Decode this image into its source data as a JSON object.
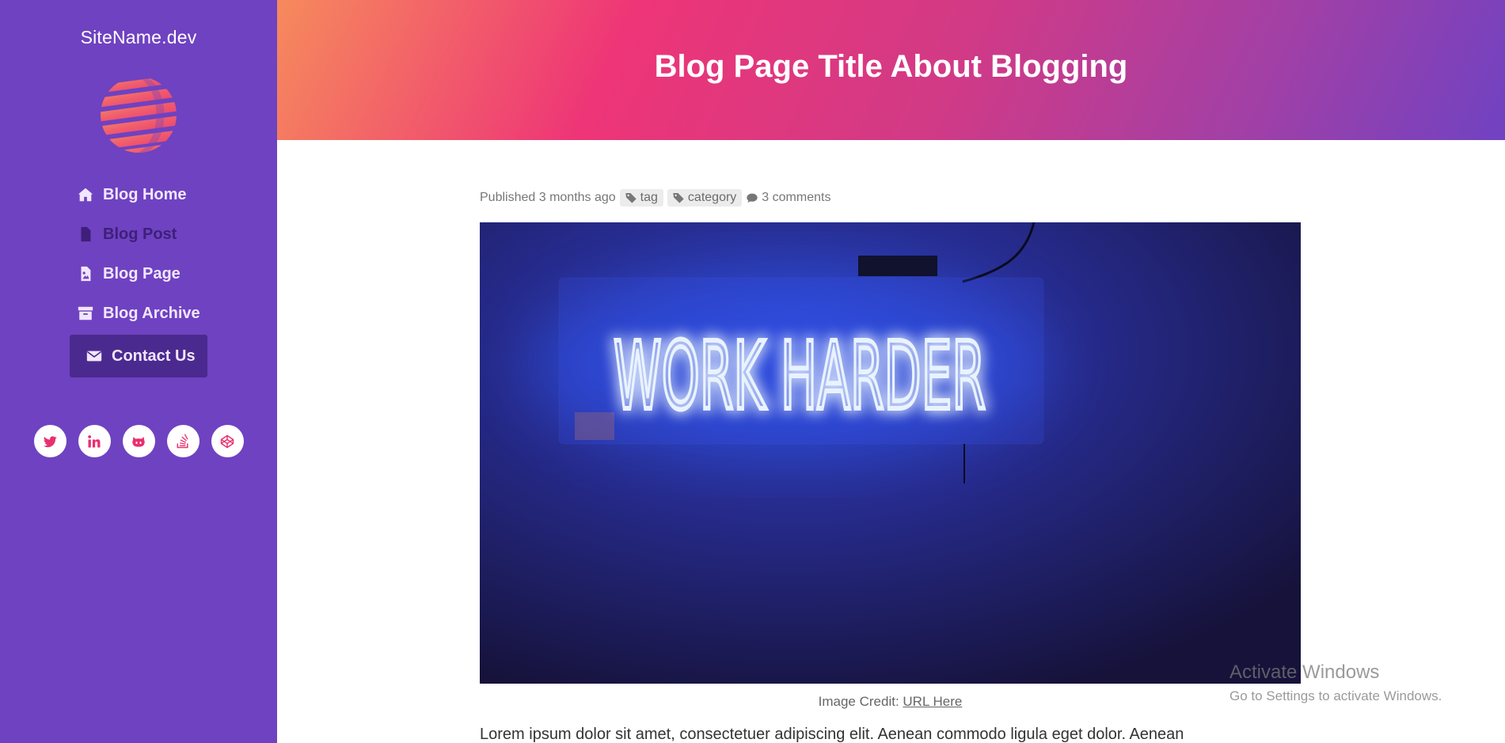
{
  "sidebar": {
    "site_name": "SiteName.dev",
    "logo_icon": "striped-globe-logo",
    "nav": [
      {
        "label": "Blog Home",
        "icon": "home-icon"
      },
      {
        "label": "Blog Post",
        "icon": "file-text-icon"
      },
      {
        "label": "Blog Page",
        "icon": "file-image-icon"
      },
      {
        "label": "Blog Archive",
        "icon": "archive-icon"
      },
      {
        "label": "Contact Us",
        "icon": "envelope-icon"
      }
    ],
    "current_item": "Blog Post",
    "socials": [
      "twitter-icon",
      "linkedin-icon",
      "github-icon",
      "stackoverflow-icon",
      "codepen-icon"
    ]
  },
  "header": {
    "title": "Blog Page Title About Blogging"
  },
  "meta": {
    "published": "Published 3 months ago",
    "tag": "tag",
    "category": "category",
    "comments": "3 comments"
  },
  "hero": {
    "sign_text": "WORK HARDER",
    "caption_prefix": "Image Credit:",
    "caption_link": "URL Here"
  },
  "body": {
    "first_line": "Lorem ipsum dolor sit amet, consectetuer adipiscing elit. Aenean commodo ligula eget dolor. Aenean"
  },
  "watermark": {
    "title": "Activate Windows",
    "subtitle": "Go to Settings to activate Windows."
  },
  "colors": {
    "sidebar": "#6f42c1",
    "accent_pink": "#ee3577",
    "accent_orange": "#f68a5c",
    "contact_bg": "#4b2a8f",
    "neon": "#1e5bff"
  }
}
